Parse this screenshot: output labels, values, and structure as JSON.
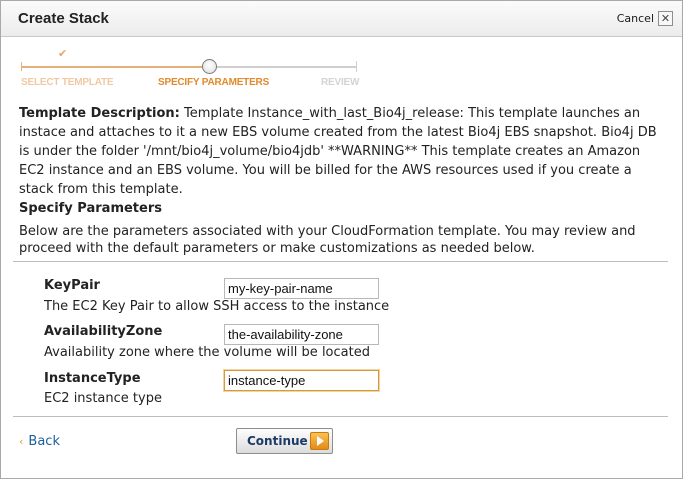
{
  "dialog": {
    "title": "Create Stack",
    "cancel_label": "Cancel",
    "close_glyph": "✕"
  },
  "wizard": {
    "check_glyph": "✔",
    "steps": [
      {
        "label": "SELECT TEMPLATE",
        "state": "done"
      },
      {
        "label": "SPECIFY PARAMETERS",
        "state": "current"
      },
      {
        "label": "REVIEW",
        "state": "todo"
      }
    ]
  },
  "template": {
    "heading": "Template Description:",
    "description": "Template Instance_with_last_Bio4j_release: This template launches an instace and attaches to it a new EBS volume created from the latest Bio4j EBS snapshot. Bio4j DB is under the folder '/mnt/bio4j_volume/bio4jdb' **WARNING** This template creates an Amazon EC2 instance and an EBS volume. You will be billed for the AWS resources used if you create a stack from this template."
  },
  "parameters_section": {
    "heading": "Specify Parameters",
    "intro": "Below are the parameters associated with your CloudFormation template. You may review and proceed with the default parameters or make customizations as needed below."
  },
  "parameters": [
    {
      "name": "KeyPair",
      "value": "my-key-pair-name",
      "description": "The EC2 Key Pair to allow SSH access to the instance"
    },
    {
      "name": "AvailabilityZone",
      "value": "the-availability-zone",
      "description": "Availability zone where the volume will be located"
    },
    {
      "name": "InstanceType",
      "value": "instance-type",
      "description": "EC2 instance type"
    }
  ],
  "footer": {
    "back_glyph": "‹",
    "back_label": "Back",
    "continue_label": "Continue"
  },
  "colors": {
    "accent_orange": "#e08a2c",
    "link_blue": "#1b5f9c"
  },
  "icons": [
    "check-icon",
    "close-icon",
    "chevron-left-icon",
    "play-arrow-icon"
  ]
}
